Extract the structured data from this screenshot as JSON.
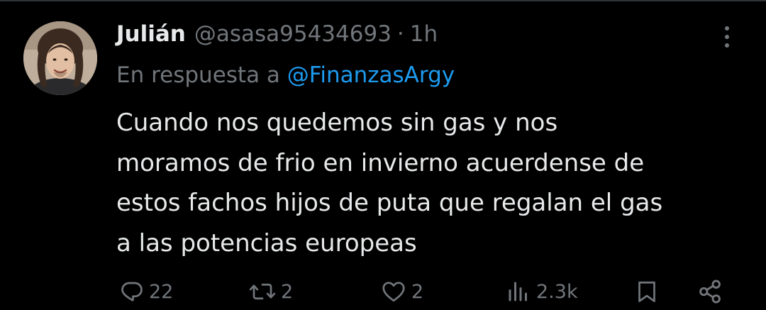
{
  "tweet": {
    "author": {
      "display_name": "Julián",
      "handle": "@asasa95434693",
      "separator": "·",
      "time": "1h"
    },
    "reply": {
      "prefix": "En respuesta a ",
      "mention": "@FinanzasArgy"
    },
    "text": "Cuando nos quedemos sin gas y nos\nmoramos de frio en invierno acuerdense de\nestos fachos hijos de puta que regalan el gas\na las potencias europeas",
    "actions": {
      "replies": "22",
      "retweets": "2",
      "likes": "2",
      "views": "2.3k"
    },
    "icons": {
      "more": "more-vertical-icon",
      "reply": "reply-icon",
      "retweet": "retweet-icon",
      "like": "heart-icon",
      "views": "views-icon",
      "bookmark": "bookmark-icon",
      "share": "share-icon"
    },
    "colors": {
      "background": "#000000",
      "text": "#e7e9ea",
      "muted": "#71767b",
      "link": "#1d9bf0"
    }
  }
}
